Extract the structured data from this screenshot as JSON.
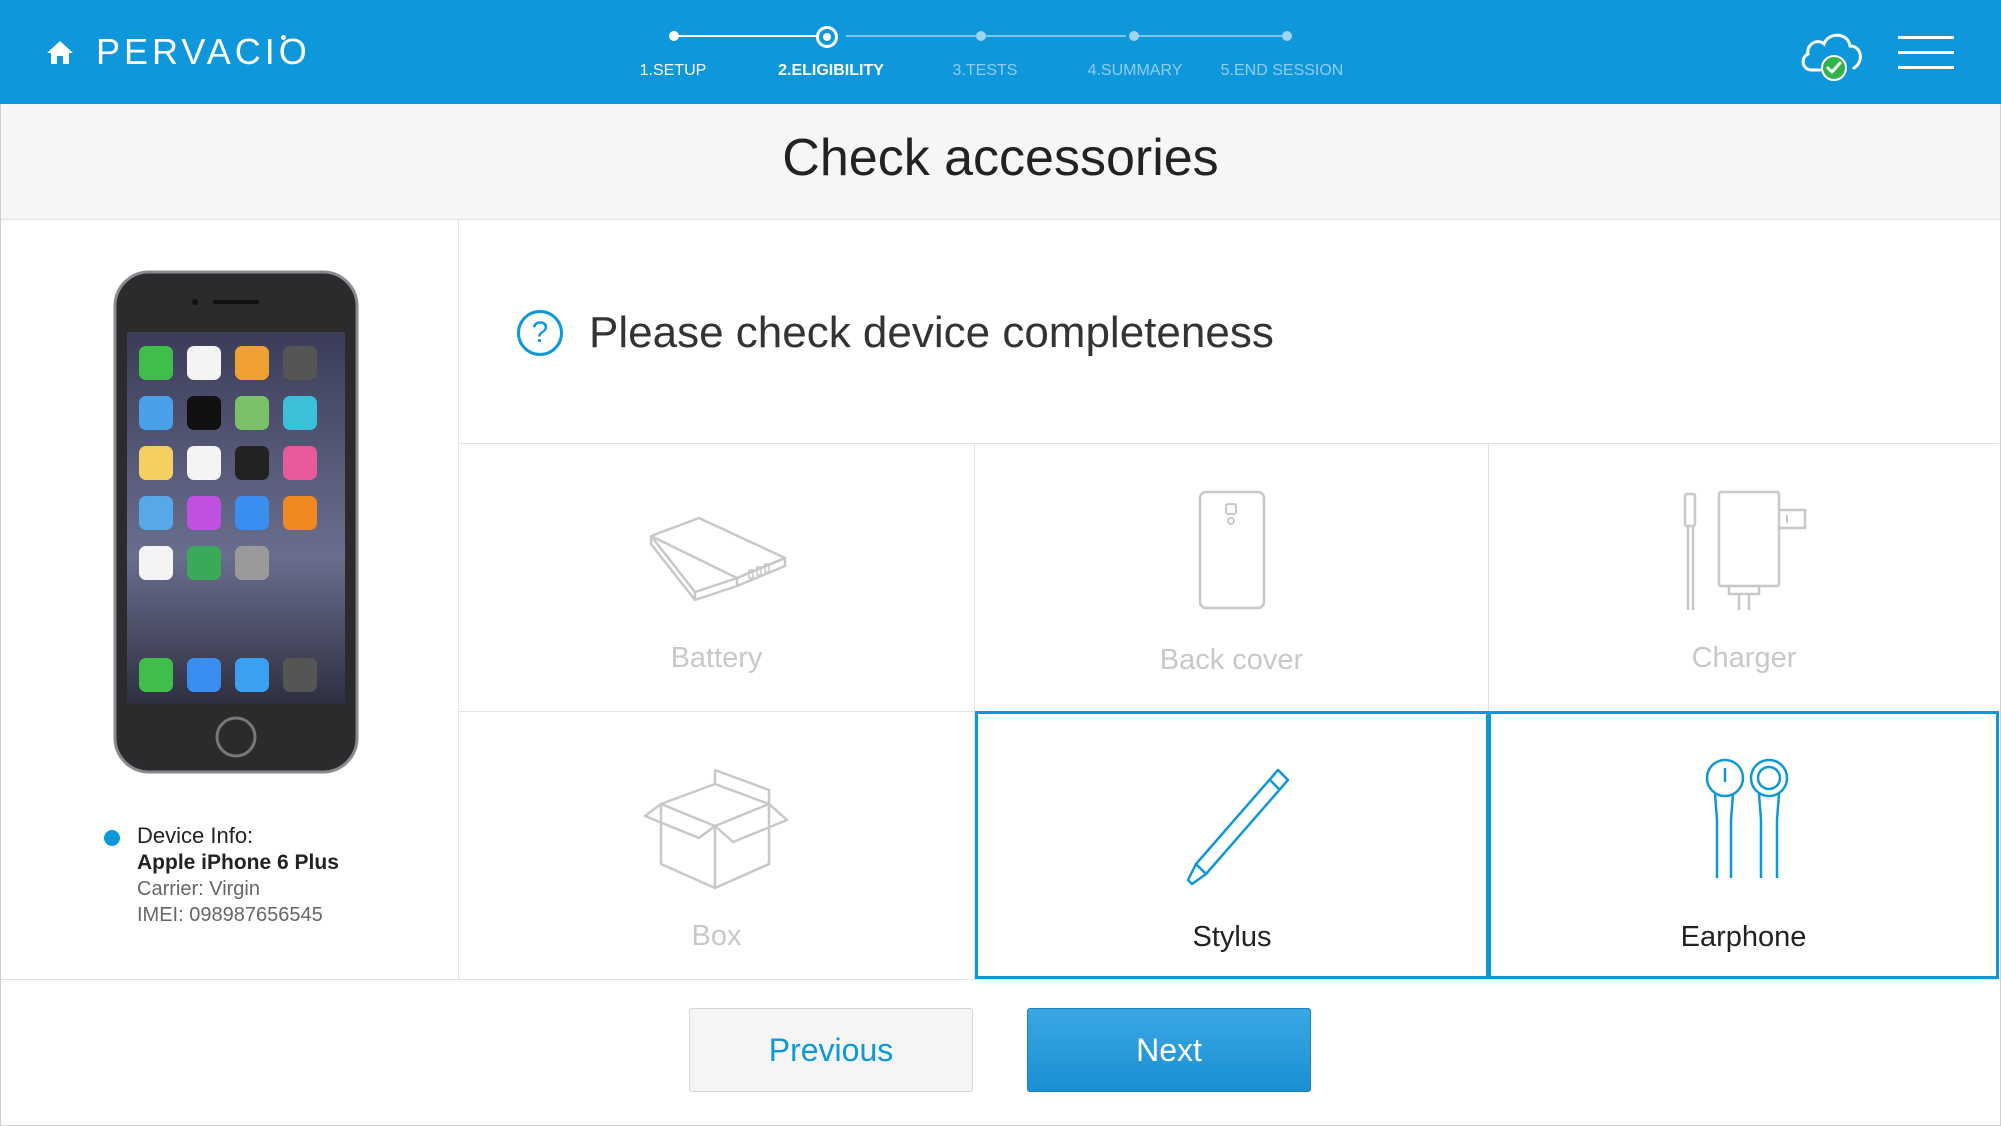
{
  "app": {
    "brand": "PERVACIO"
  },
  "steps": [
    {
      "label": "1.SETUP",
      "state": "done"
    },
    {
      "label": "2.ELIGIBILITY",
      "state": "active"
    },
    {
      "label": "3.TESTS",
      "state": "pending"
    },
    {
      "label": "4.SUMMARY",
      "state": "pending"
    },
    {
      "label": "5.END SESSION",
      "state": "pending"
    }
  ],
  "page": {
    "title": "Check accessories",
    "question": "Please check device completeness",
    "question_icon": "?"
  },
  "device": {
    "info_label": "Device Info:",
    "model": "Apple iPhone 6 Plus",
    "carrier": "Carrier: Virgin",
    "imei": "IMEI: 098987656545"
  },
  "accessories": [
    {
      "label": "Battery",
      "icon": "battery-icon",
      "selected": false
    },
    {
      "label": "Back cover",
      "icon": "back-cover-icon",
      "selected": false
    },
    {
      "label": "Charger",
      "icon": "charger-icon",
      "selected": false
    },
    {
      "label": "Box",
      "icon": "box-icon",
      "selected": false
    },
    {
      "label": "Stylus",
      "icon": "stylus-icon",
      "selected": true
    },
    {
      "label": "Earphone",
      "icon": "earphone-icon",
      "selected": true
    }
  ],
  "buttons": {
    "previous": "Previous",
    "next": "Next"
  },
  "colors": {
    "accent": "#0f97db",
    "inactive": "#c8c8c8"
  },
  "header_icons": [
    "home-icon",
    "cloud-check-icon",
    "hamburger-menu-icon"
  ]
}
